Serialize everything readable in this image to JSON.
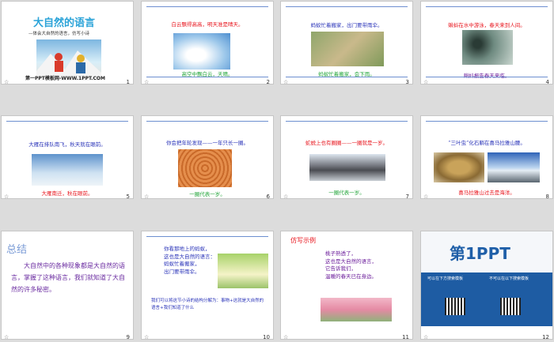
{
  "slides": [
    {
      "num": "1",
      "title": "大自然的语言",
      "subtitle": "—体会大自然的语言，仿写小诗",
      "footer": "第一PPT模板网-WWW.1PPT.COM"
    },
    {
      "num": "2",
      "line1": "白云飘得高高，明天准是晴天。",
      "line2": "高空中飘白云，天晴。"
    },
    {
      "num": "3",
      "line1": "蚂蚁忙着搬家，出门要带雨伞。",
      "line2": "蚂蚁忙着搬家，会下雨。"
    },
    {
      "num": "4",
      "line1": "蝌蚪在水中游泳，春天来到人间。",
      "line2": "蝌蚪报告春天来临。"
    },
    {
      "num": "5",
      "line1": "大雁在排队南飞，秋天就在眼前。",
      "line2": "大雁南迁，秋在眼前。"
    },
    {
      "num": "6",
      "line1": "你会把年轮发现——一年只长一圈。",
      "line2": "一圈代表一岁。"
    },
    {
      "num": "7",
      "line1": "蛇蜕上也有圈圈——一圈就是一岁。",
      "line2": "一圈代表一岁。"
    },
    {
      "num": "8",
      "line1": "“三叶虫”化石躺在喜马拉雅山腰。",
      "line2": "喜马拉雅山过去是海洋。"
    },
    {
      "num": "9",
      "heading": "总结",
      "body": "大自然中的各种现象都是大自然的语言，掌握了这种语言，我们就知道了大自然的许多秘密。"
    },
    {
      "num": "10",
      "poem": [
        "你看那地上的蚂蚁，",
        "这也是大自然的语言：",
        "蚂蚁忙着搬家，",
        "出门要带雨伞。"
      ],
      "caption": "我们可以将这节小诗的结构分解为：事物+这就是大自然的语言+我们知道了什么"
    },
    {
      "num": "11",
      "heading": "仿写示例",
      "poem": [
        "桃子熟透了，",
        "这也是大自然的语言，",
        "它告诉我们，",
        "温暖的春天已在身边。"
      ]
    },
    {
      "num": "12",
      "brand": "第1PPT",
      "small1": "可以在下方搜索模板",
      "small2": "不可以在以下搜索模板"
    }
  ],
  "star": "☆"
}
